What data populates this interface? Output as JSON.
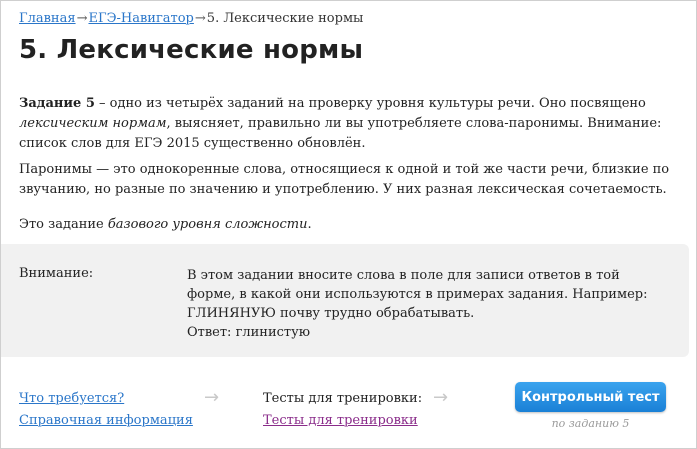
{
  "breadcrumb": {
    "home": "Главная",
    "sep1": "→",
    "navigator": "ЕГЭ-Навигатор",
    "sep2": "→",
    "current": "5. Лексические нормы"
  },
  "page_title": "5. Лексические нормы",
  "intro": {
    "task_label": "Задание 5",
    "text_a": " – одно из четырёх заданий на проверку уровня культуры речи. Оно посвящено ",
    "emph": "лексическим нормам",
    "text_b": ", выясняет, правильно ли вы употребляете слова-паронимы. Внимание: список слов для ЕГЭ 2015 существенно обновлён."
  },
  "paronyms_text": "Паронимы — это однокоренные слова, относящиеся к одной и той же части речи, близкие по звучанию, но разные по значению и употреблению. У них разная лексическая сочетаемость.",
  "level": {
    "text_a": "Это задание ",
    "emph": "базового уровня сложности",
    "text_b": "."
  },
  "notice": {
    "label": "Внимание:",
    "line": "В этом задании вносите слова в поле для записи ответов в той форме, в какой они используются в примерах задания. Например: ГЛИНЯНУЮ почву трудно обрабатывать.",
    "answer": "Ответ: глинистую"
  },
  "bottom": {
    "what_required": "Что требуется?",
    "reference": "Справочная информация",
    "arrow": "→",
    "tests_title": "Тесты для тренировки:",
    "tests_link": "Тесты для тренировки",
    "cta_label": "Контрольный тест",
    "cta_sub": "по заданию 5"
  },
  "colors": {
    "link": "#2a76c9",
    "visited_link": "#8a2c8a",
    "button": "#1a80d6",
    "notice_bg": "#f1f1f1"
  }
}
